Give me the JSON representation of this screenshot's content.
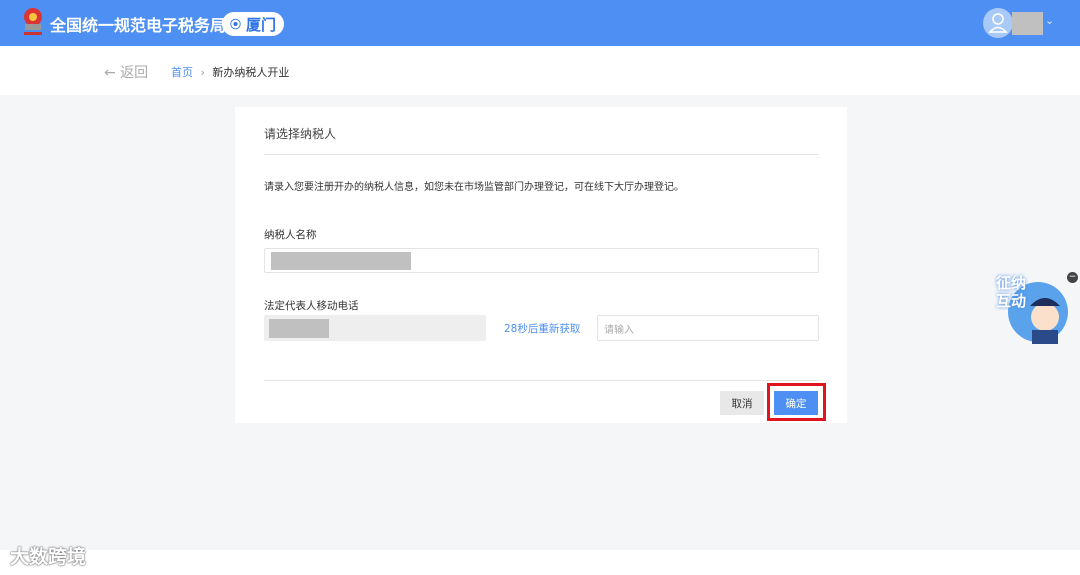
{
  "header": {
    "title": "全国统一规范电子税务局",
    "city": "厦门"
  },
  "nav": {
    "back": "← 返回",
    "home": "首页",
    "separator": "›",
    "current": "新办纳税人开业"
  },
  "card": {
    "title": "请选择纳税人",
    "hint": "请录入您要注册开办的纳税人信息，如您未在市场监管部门办理登记，可在线下大厅办理登记。",
    "name_label": "纳税人名称",
    "phone_label": "法定代表人移动电话",
    "resend": "28秒后重新获取",
    "code_placeholder": "请输入",
    "cancel": "取消",
    "confirm": "确定"
  },
  "widget": {
    "label": "征纳互动"
  },
  "watermark": "大数跨境",
  "colors": {
    "brand": "#4d8ff2",
    "highlight": "#e0141e"
  }
}
